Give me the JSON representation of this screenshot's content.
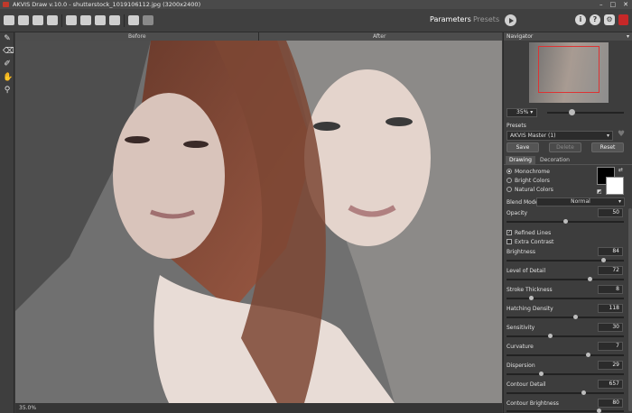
{
  "window": {
    "title": "AKVIS Draw v.10.0 - shutterstock_1019106112.jpg (3200x2400)",
    "controls": [
      "–",
      "□",
      "✕"
    ]
  },
  "toolbar": {
    "parameters_label": "Parameters",
    "presets_label": "Presets"
  },
  "canvas": {
    "before_label": "Before",
    "after_label": "After"
  },
  "status": {
    "zoom_text": "35.0%"
  },
  "navigator": {
    "title": "Navigator",
    "zoom": "35%"
  },
  "presets": {
    "title": "Presets",
    "selected": "AKVIS Master (1)",
    "save": "Save",
    "delete": "Delete",
    "reset": "Reset"
  },
  "tabs": {
    "drawing": "Drawing",
    "decoration": "Decoration"
  },
  "modes": {
    "monochrome": "Monochrome",
    "bright": "Bright Colors",
    "natural": "Natural Colors",
    "selected": "monochrome"
  },
  "blend": {
    "label": "Blend Mode",
    "value": "Normal"
  },
  "checkboxes": {
    "refined": "Refined Lines",
    "extra": "Extra Contrast",
    "refined_checked": true,
    "extra_checked": false
  },
  "params": [
    {
      "label": "Opacity",
      "value": "50",
      "fraction": 0.5
    },
    {
      "label": "Brightness",
      "value": "84",
      "fraction": 0.84
    },
    {
      "label": "Level of Detail",
      "value": "72",
      "fraction": 0.72
    },
    {
      "label": "Stroke Thickness",
      "value": "8",
      "fraction": 0.2
    },
    {
      "label": "Hatching Density",
      "value": "118",
      "fraction": 0.59
    },
    {
      "label": "Sensitivity",
      "value": "30",
      "fraction": 0.37
    },
    {
      "label": "Curvature",
      "value": "7",
      "fraction": 0.7
    },
    {
      "label": "Dispersion",
      "value": "29",
      "fraction": 0.29
    },
    {
      "label": "Contour Detail",
      "value": "657",
      "fraction": 0.66
    },
    {
      "label": "Contour Brightness",
      "value": "80",
      "fraction": 0.8
    }
  ],
  "colors": {
    "accent": "#c62828",
    "panel": "#3d3d3d",
    "background": "#3b3b3b"
  },
  "icons": [
    "brush-icon",
    "eraser-icon",
    "history-brush-icon",
    "hand-icon",
    "zoom-icon"
  ]
}
